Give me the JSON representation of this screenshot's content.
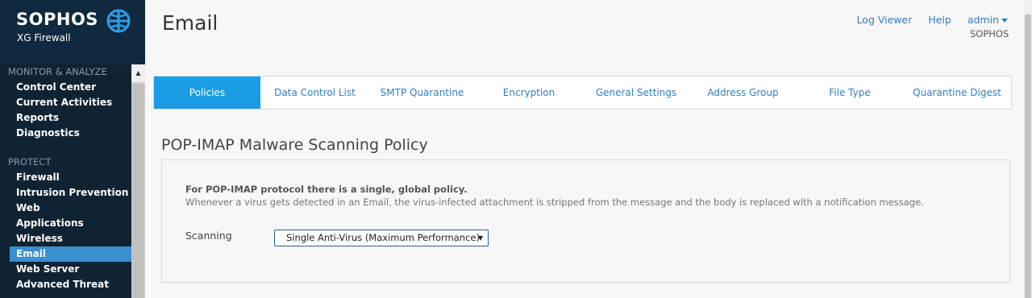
{
  "brand": {
    "name": "SOPHOS",
    "product": "XG Firewall"
  },
  "nav": {
    "monitor_heading": "MONITOR & ANALYZE",
    "monitor_items": [
      "Control Center",
      "Current Activities",
      "Reports",
      "Diagnostics"
    ],
    "protect_heading": "PROTECT",
    "protect_items": [
      "Firewall",
      "Intrusion Prevention",
      "Web",
      "Applications",
      "Wireless",
      "Email",
      "Web Server",
      "Advanced Threat"
    ],
    "active_item": "Email"
  },
  "header": {
    "title": "Email",
    "log_viewer": "Log Viewer",
    "help": "Help",
    "user": "admin",
    "organization": "SOPHOS"
  },
  "tabs": [
    {
      "label": "Policies",
      "active": true
    },
    {
      "label": "Data Control List",
      "active": false
    },
    {
      "label": "SMTP Quarantine",
      "active": false
    },
    {
      "label": "Encryption",
      "active": false
    },
    {
      "label": "General Settings",
      "active": false
    },
    {
      "label": "Address Group",
      "active": false
    },
    {
      "label": "File Type",
      "active": false
    },
    {
      "label": "Quarantine Digest",
      "active": false
    }
  ],
  "section": {
    "title": "POP-IMAP Malware Scanning Policy",
    "info_bold": "For POP-IMAP protocol there is a single, global policy.",
    "info_text": "Whenever a virus gets detected in an Email, the virus-infected attachment is stripped from the message and the body is replaced with a notification message.",
    "scanning_label": "Scanning",
    "scanning_value": "Single Anti-Virus (Maximum Performance)"
  },
  "colors": {
    "sidebar_bg": "#10293e",
    "active_nav": "#3a8fcf",
    "active_tab": "#1a9de4",
    "link": "#2f7fc1"
  },
  "icons": {
    "logo": "sophos-shield-icon",
    "scroll_up": "triangle-up-icon",
    "select_arrow": "triangle-down-icon",
    "user_menu": "caret-down-icon"
  }
}
